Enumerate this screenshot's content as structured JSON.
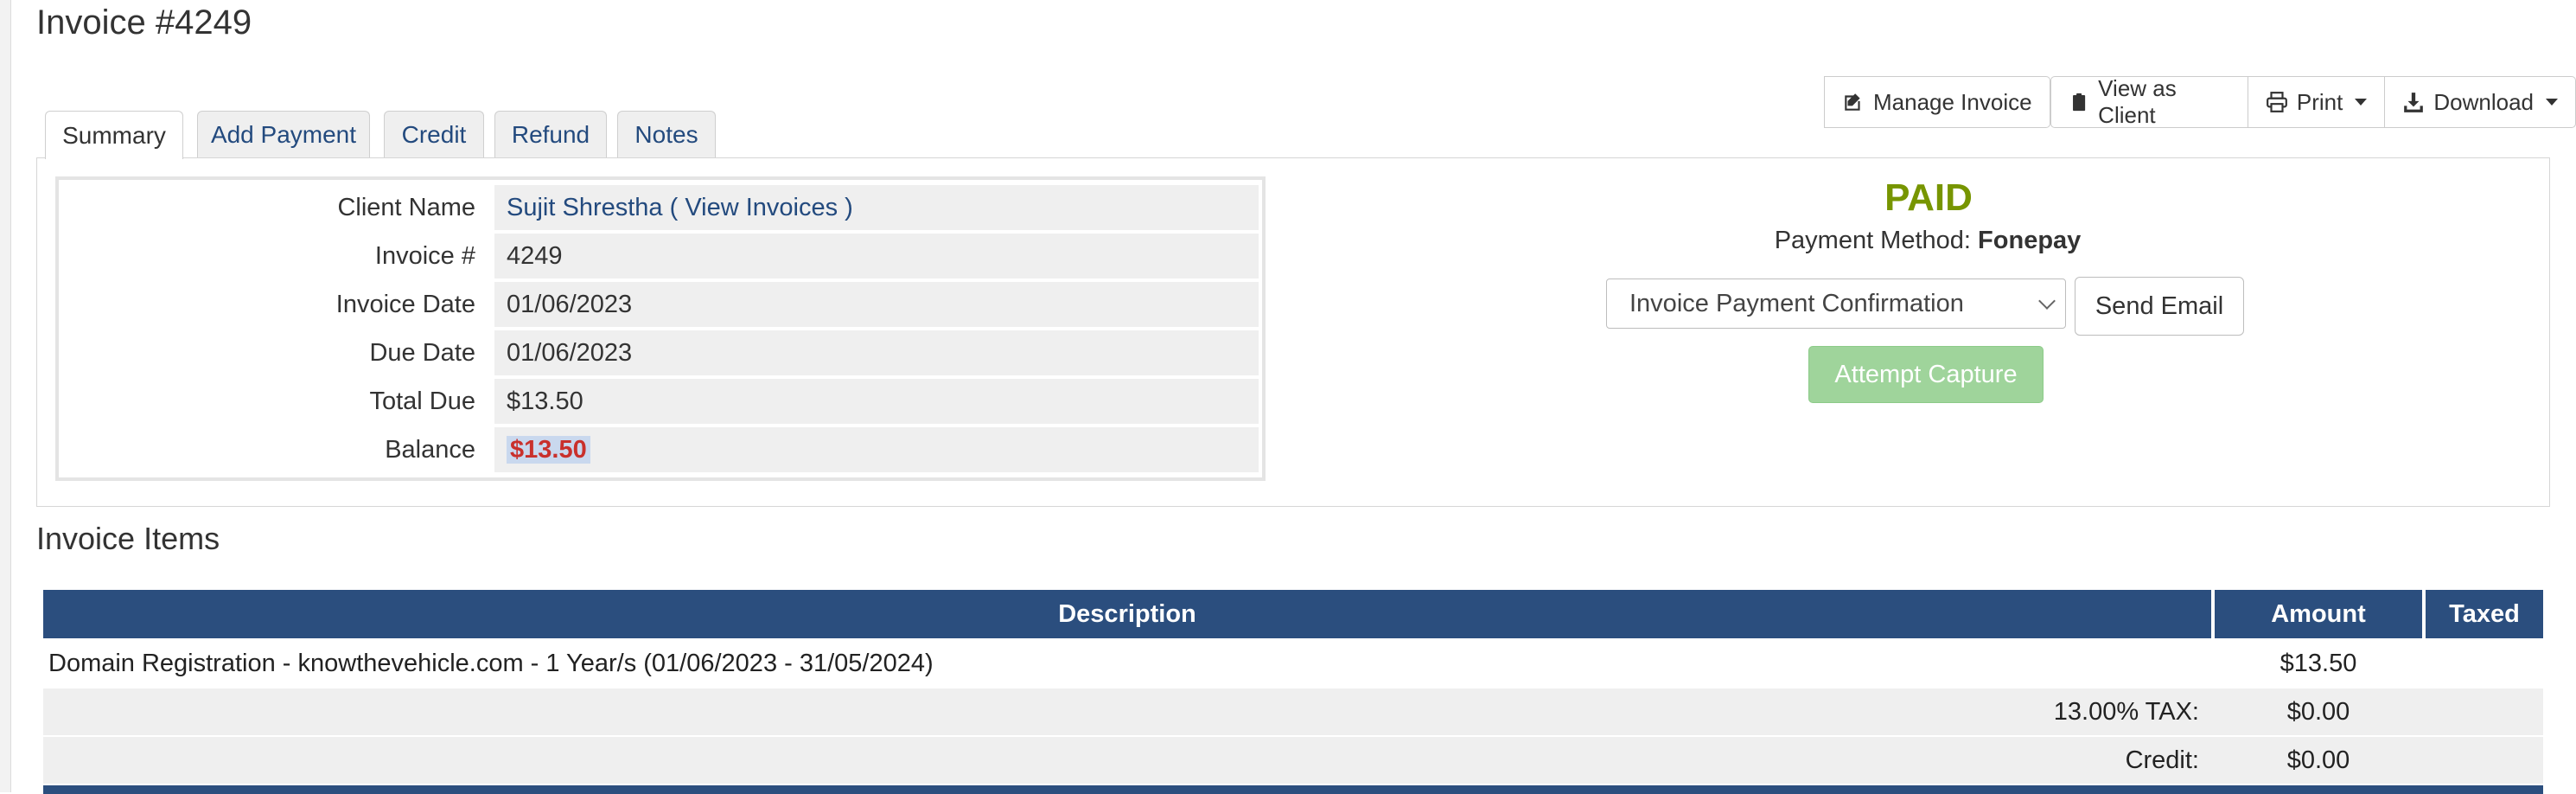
{
  "page": {
    "title": "Invoice #4249"
  },
  "tabs": [
    {
      "label": "Summary",
      "active": true
    },
    {
      "label": "Add Payment"
    },
    {
      "label": "Credit"
    },
    {
      "label": "Refund"
    },
    {
      "label": "Notes"
    }
  ],
  "actions": {
    "manage_invoice": "Manage Invoice",
    "view_as_client": "View as Client",
    "print": "Print",
    "download": "Download"
  },
  "summary": {
    "client_name_label": "Client Name",
    "client_name": "Sujit Shrestha",
    "view_invoices_prefix": "( ",
    "view_invoices_link": "View Invoices",
    "view_invoices_suffix": " )",
    "invoice_num_label": "Invoice #",
    "invoice_num": "4249",
    "invoice_date_label": "Invoice Date",
    "invoice_date": "01/06/2023",
    "due_date_label": "Due Date",
    "due_date": "01/06/2023",
    "total_due_label": "Total Due",
    "total_due": "$13.50",
    "balance_label": "Balance",
    "balance": "$13.50"
  },
  "status_panel": {
    "status": "PAID",
    "payment_method_label": "Payment Method:",
    "payment_method": "Fonepay",
    "email_template_selected": "Invoice Payment Confirmation",
    "send_email": "Send Email",
    "attempt_capture": "Attempt Capture"
  },
  "items": {
    "section_title": "Invoice Items",
    "headers": {
      "description": "Description",
      "amount": "Amount",
      "taxed": "Taxed"
    },
    "rows": [
      {
        "description": "Domain Registration - knowthevehicle.com - 1 Year/s (01/06/2023 - 31/05/2024)",
        "amount": "$13.50",
        "taxed": ""
      }
    ],
    "totals": [
      {
        "label": "13.00% TAX:",
        "amount": "$0.00"
      },
      {
        "label": "Credit:",
        "amount": "$0.00"
      }
    ]
  },
  "colors": {
    "header_blue": "#2b4e7e",
    "paid_green": "#779500",
    "balance_red": "#c9302c",
    "capture_green": "#9fd49b"
  }
}
